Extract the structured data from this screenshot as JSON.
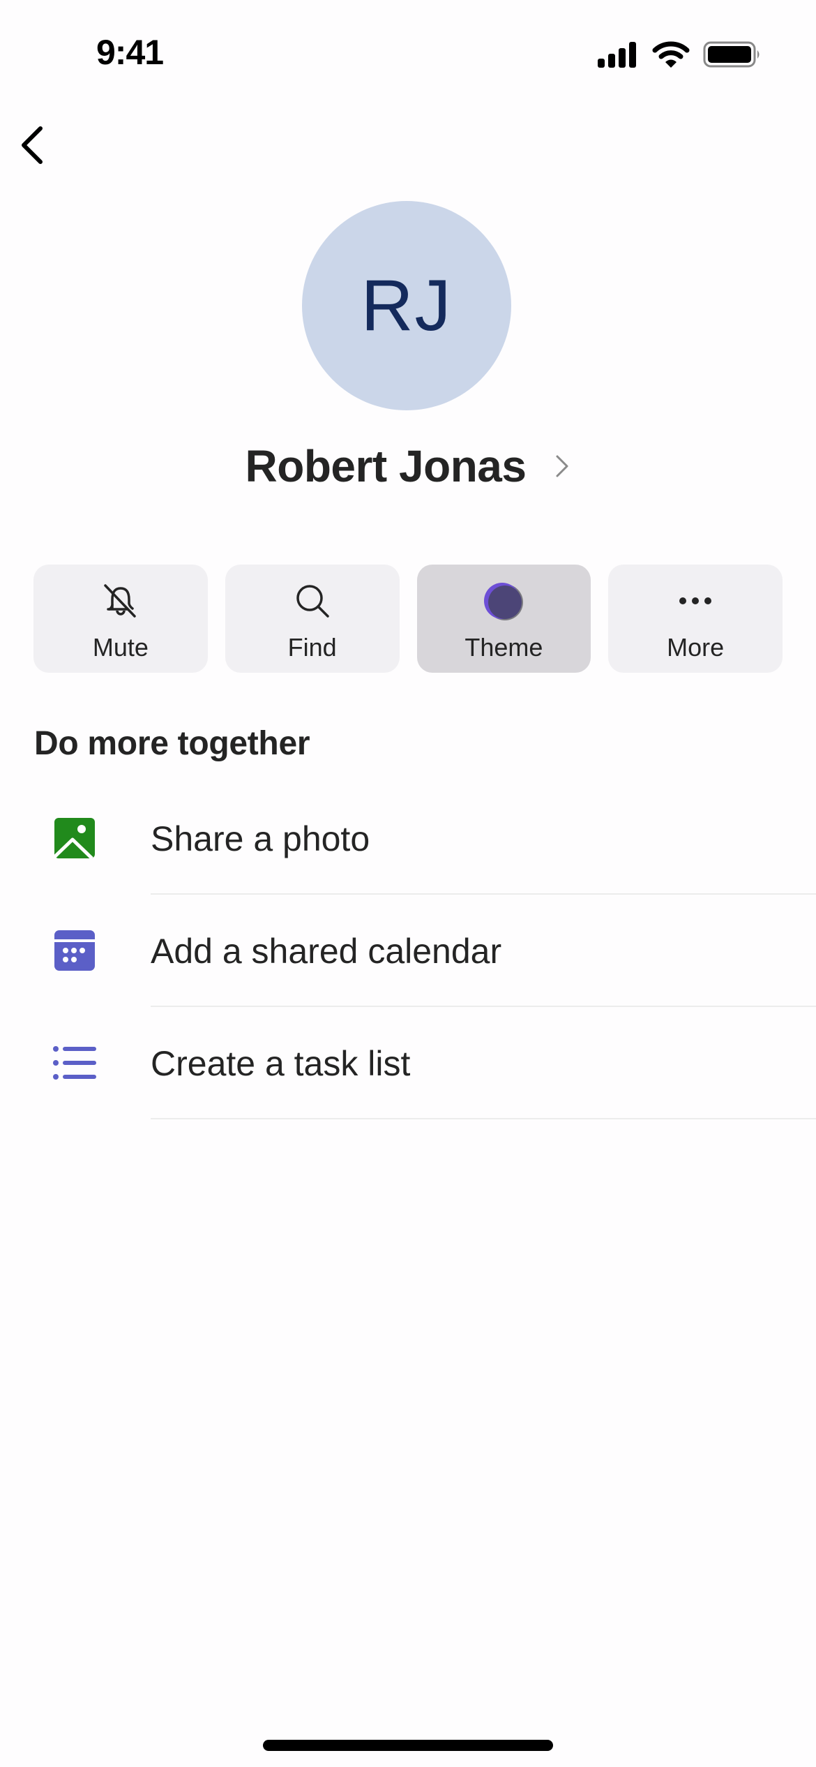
{
  "status_bar": {
    "time": "9:41",
    "icons": [
      "cellular-signal-icon",
      "wifi-icon",
      "battery-icon"
    ]
  },
  "nav": {
    "back_icon": "chevron-left-icon"
  },
  "profile": {
    "initials": "RJ",
    "name": "Robert Jonas",
    "avatar_bg": "#cbd6e9",
    "avatar_fg": "#142a5c"
  },
  "actions": [
    {
      "label": "Mute",
      "icon": "bell-off-icon",
      "selected": false
    },
    {
      "label": "Find",
      "icon": "search-icon",
      "selected": false
    },
    {
      "label": "Theme",
      "icon": "theme-icon",
      "selected": true
    },
    {
      "label": "More",
      "icon": "more-horizontal-icon",
      "selected": false
    }
  ],
  "section": {
    "title": "Do more together",
    "items": [
      {
        "label": "Share a photo",
        "icon": "photo-icon",
        "color": "#218a1c"
      },
      {
        "label": "Add a shared calendar",
        "icon": "calendar-icon",
        "color": "#5b5fc7"
      },
      {
        "label": "Create a task list",
        "icon": "task-list-icon",
        "color": "#5b5fc7"
      }
    ]
  }
}
